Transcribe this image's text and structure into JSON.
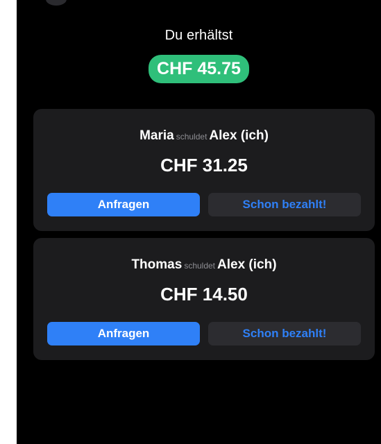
{
  "header": {
    "label": "Du erhältst",
    "total": "CHF 45.75"
  },
  "colors": {
    "background": "#000000",
    "card": "#1c1c1e",
    "total_pill": "#2fbf7a",
    "accent": "#2f80f7",
    "secondary_button": "#2c2c30",
    "muted_text": "#8e8e93"
  },
  "debts": [
    {
      "debtor": "Maria",
      "verb": "schuldet",
      "creditor": "Alex (ich)",
      "amount": "CHF 31.25",
      "request_label": "Anfragen",
      "paid_label": "Schon bezahlt!"
    },
    {
      "debtor": "Thomas",
      "verb": "schuldet",
      "creditor": "Alex (ich)",
      "amount": "CHF 14.50",
      "request_label": "Anfragen",
      "paid_label": "Schon bezahlt!"
    }
  ]
}
